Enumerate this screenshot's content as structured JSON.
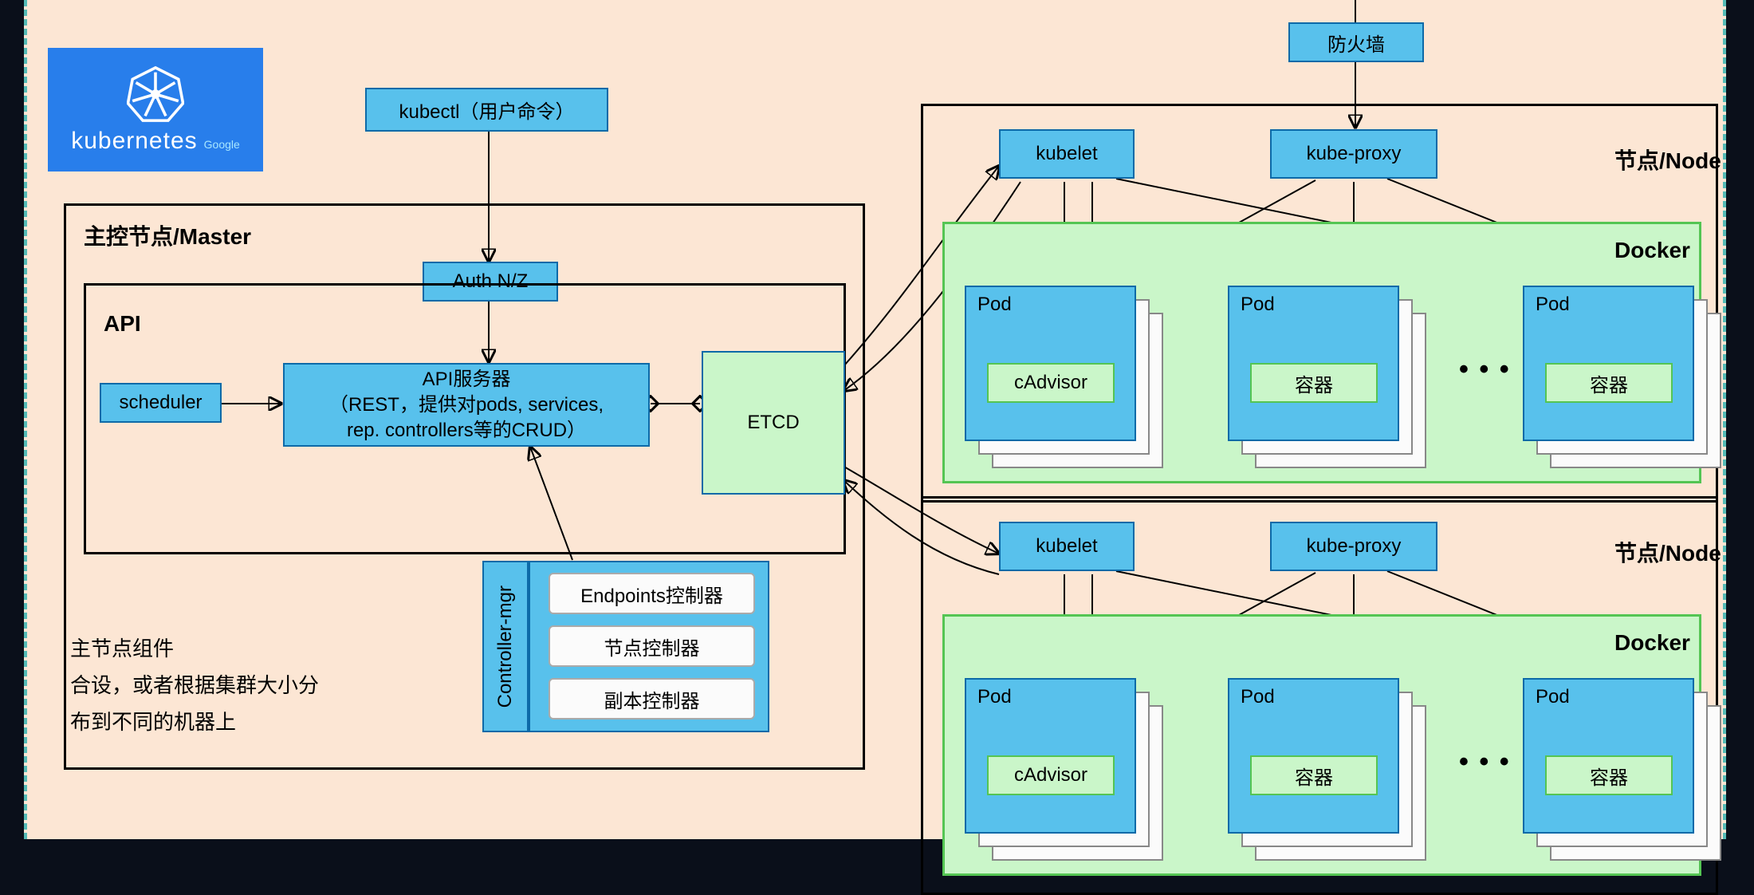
{
  "logo": {
    "name": "kubernetes",
    "sub": "Google"
  },
  "kubectl": "kubectl（用户命令）",
  "firewall": "防火墙",
  "master": {
    "title": "主控节点/Master",
    "api_title": "API",
    "auth": "Auth N/Z",
    "scheduler": "scheduler",
    "apiserver": {
      "l1": "API服务器",
      "l2": "（REST，提供对pods, services,",
      "l3": "rep. controllers等的CRUD）"
    },
    "etcd": "ETCD",
    "ctl": {
      "title": "Controller-mgr",
      "b1": "Endpoints控制器",
      "b2": "节点控制器",
      "b3": "副本控制器"
    }
  },
  "note": {
    "l1": "主节点组件",
    "l2": "合设，或者根据集群大小分",
    "l3": "布到不同的机器上"
  },
  "node": {
    "title": "节点/Node",
    "kubelet": "kubelet",
    "kubeproxy": "kube-proxy",
    "docker": "Docker",
    "pod": "Pod",
    "cadvisor": "cAdvisor",
    "container": "容器",
    "dots": "• • •"
  }
}
